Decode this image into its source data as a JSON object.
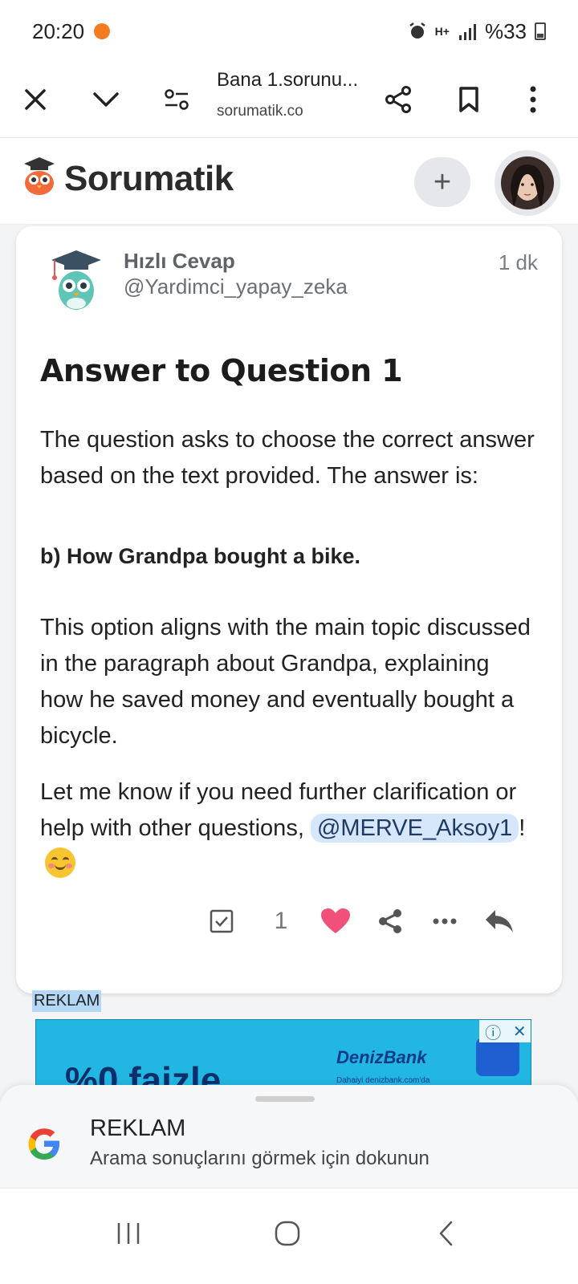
{
  "status_bar": {
    "time": "20:20",
    "network": "H+",
    "battery": "%33"
  },
  "browser": {
    "page_title": "Bana 1.sorunu...",
    "url": "sorumatik.co"
  },
  "site": {
    "brand": "Sorumatik",
    "add_label": "+"
  },
  "post": {
    "author_name": "Hızlı Cevap",
    "author_handle": "@Yardimci_yapay_zeka",
    "time": "1 dk",
    "title": "Answer to Question 1",
    "intro": "The question asks to choose the correct answer based on the text provided. The answer is:",
    "answer": "b) How Grandpa bought a bike.",
    "explanation": "This option aligns with the main topic discussed in the paragraph about Grandpa, explaining how he saved money and eventually bought a bicycle.",
    "closing": "Let me know if you need further clarification or help with other questions,",
    "mention": "@MERVE_Aksoy1",
    "exclamation": "!",
    "like_count": "1"
  },
  "ad": {
    "label": "REKLAM",
    "headline": "%0 faizle",
    "bank": "DenizBank",
    "bank_sub": "Dahaiyi denizbank.com'da"
  },
  "bottom_sheet": {
    "title": "REKLAM",
    "subtitle": "Arama sonuçlarını görmek için dokunun"
  },
  "colors": {
    "like": "#f0507a",
    "mention_bg": "#d7e7fb",
    "ad_bg": "#22b6e3"
  }
}
